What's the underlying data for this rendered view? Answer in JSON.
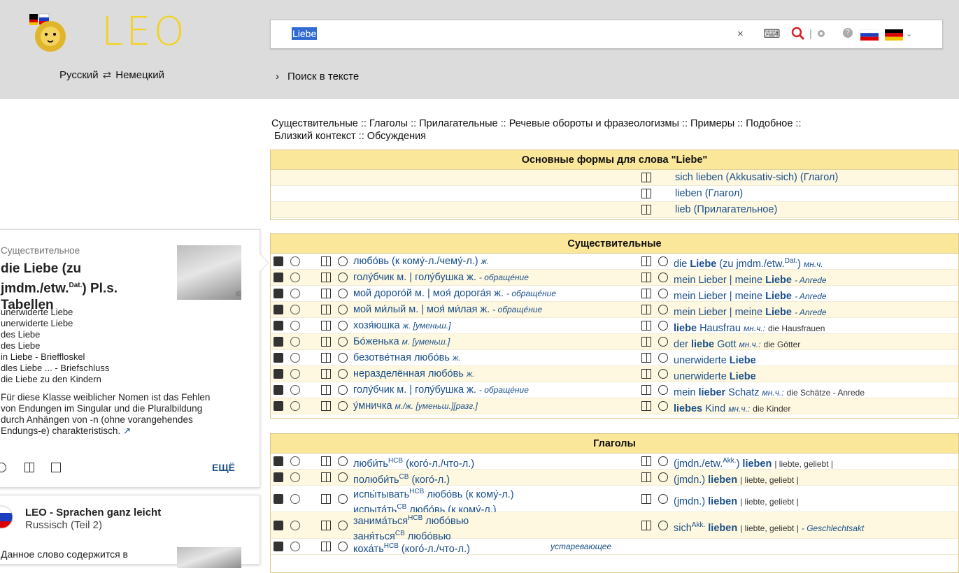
{
  "header": {
    "logo_text": "LEO",
    "lang_from": "Русский",
    "lang_swap": "⇄",
    "lang_to": "Немецкий",
    "fulltext_link": "Поиск в тексте"
  },
  "search": {
    "value": "Liebe",
    "clear": "×",
    "keyboard": "⌨",
    "search_icon": "magnifier-icon",
    "settings_icon": "gear-icon",
    "help": "?"
  },
  "nav": {
    "line1": "Существительные :: Глаголы :: Прилагательные :: Речевые обороты и фразеологизмы :: Примеры :: Подобное ::",
    "line2": "Близкий контекст :: Обсуждения"
  },
  "baseforms": {
    "title": "Основные формы для слова \"Liebe\"",
    "rows": [
      "sich lieben (Akkusativ-sich) (Глагол)",
      "lieben (Глагол)",
      "lieb (Прилагательное)"
    ]
  },
  "nouns": {
    "title": "Существительные",
    "rows": [
      {
        "l": "любо́вь (к кому́-л./чему́-л.)",
        "lt": "ж.",
        "r1": "die ",
        "rb": "Liebe",
        "r2": " (zu jmdm./etw.",
        "rsup": "Dat.",
        "r3": ")",
        "rt": "мн.ч.",
        "rg": ""
      },
      {
        "l": "голу́бчик м. | голу́бушка ж.",
        "lt": "- обраще́ние",
        "r1": "mein Lieber | meine ",
        "rb": "Liebe",
        "r2": "",
        "rsup": "",
        "r3": "",
        "rt": "- Anrede",
        "rg": ""
      },
      {
        "l": "мой дорого́й м. | моя́ дорога́я ж.",
        "lt": "- обраще́ние",
        "r1": "mein Lieber | meine ",
        "rb": "Liebe",
        "r2": "",
        "rsup": "",
        "r3": "",
        "rt": "- Anrede",
        "rg": ""
      },
      {
        "l": "мой ми́лый м. | моя́ ми́лая ж.",
        "lt": "- обраще́ние",
        "r1": "mein Lieber | meine ",
        "rb": "Liebe",
        "r2": "",
        "rsup": "",
        "r3": "",
        "rt": "- Anrede",
        "rg": ""
      },
      {
        "l": "хозя́юшка",
        "lt": "ж. [уменьш.]",
        "r1": "",
        "rb": "liebe",
        "r2": " Hausfrau",
        "rsup": "",
        "r3": "",
        "rt": "мн.ч.:",
        "rg": "die Hausfrauen"
      },
      {
        "l": "Бо́женька",
        "lt": "м. [уменьш.]",
        "r1": "der ",
        "rb": "liebe",
        "r2": " Gott",
        "rsup": "",
        "r3": "",
        "rt": "мн.ч.:",
        "rg": "die Götter"
      },
      {
        "l": "безотве́тная любо́вь",
        "lt": "ж.",
        "r1": "unerwiderte ",
        "rb": "Liebe",
        "r2": "",
        "rsup": "",
        "r3": "",
        "rt": "",
        "rg": ""
      },
      {
        "l": "неразделённая любо́вь",
        "lt": "ж.",
        "r1": "unerwiderte ",
        "rb": "Liebe",
        "r2": "",
        "rsup": "",
        "r3": "",
        "rt": "",
        "rg": ""
      },
      {
        "l": "голу́бчик м. | голу́бушка ж.",
        "lt": "- обраще́ние",
        "r1": "mein ",
        "rb": "lieber",
        "r2": " Schatz",
        "rsup": "",
        "r3": "",
        "rt": "мн.ч.:",
        "rg": "die Schätze  - Anrede"
      },
      {
        "l": "у́мничка",
        "lt": "м./ж. [уменьш.][разг.]",
        "r1": "",
        "rb": "liebes",
        "r2": " Kind",
        "rsup": "",
        "r3": "",
        "rt": "мн.ч.:",
        "rg": "die Kinder"
      }
    ]
  },
  "verbs": {
    "title": "Глаголы",
    "rows": [
      {
        "l": "люби́ть",
        "lsup": "НСВ",
        "l2": " (кого́-л./что-л.)",
        "l3": "",
        "l3sup": "",
        "l4": "",
        "r1": "(jmdn./etw.",
        "rsup": "Akk.",
        "r2": ") ",
        "rb": "lieben",
        "rg": "| liebte, geliebt |",
        "rt": ""
      },
      {
        "l": "полюби́ть",
        "lsup": "СВ",
        "l2": " (кого́-л.)",
        "l3": "",
        "l3sup": "",
        "l4": "",
        "r1": "(jmdn.) ",
        "rsup": "",
        "r2": "",
        "rb": "lieben",
        "rg": "| liebte, geliebt |",
        "rt": ""
      },
      {
        "l": "испы́тывать",
        "lsup": "НСВ",
        "l2": " любо́вь (к кому́-л.)",
        "l3": "испыта́ть",
        "l3sup": "СВ",
        "l4": " любо́вь (к кому́-л.)",
        "r1": "(jmdn.) ",
        "rsup": "",
        "r2": "",
        "rb": "lieben",
        "rg": "| liebte, geliebt |",
        "rt": ""
      },
      {
        "l": "занима́ться",
        "lsup": "НСВ",
        "l2": " любо́вью",
        "l3": "заня́ться",
        "l3sup": "СВ",
        "l4": " любо́вью",
        "r1": "sich",
        "rsup": "Akk.",
        "r2": " ",
        "rb": "lieben",
        "rg": "| liebte, geliebt |",
        "rt": "- Geschlechtsakt"
      },
      {
        "l": "коха́ть",
        "lsup": "НСВ",
        "l2": " (кого́-л./что-л.)",
        "l3": "",
        "l3sup": "",
        "l4": "",
        "r1": "",
        "rsup": "",
        "r2": "",
        "rb": "",
        "rg": "",
        "rt": "устаревающее"
      }
    ]
  },
  "card1": {
    "category": "Существительное",
    "title_a": "die Liebe (zu",
    "title_b": "jmdm./etw.",
    "title_sup": "Dat.",
    "title_c": ") Pl.s.",
    "title_d": "Tabellen",
    "lines": [
      "unerwiderte Liebe",
      "unerwiderte Liebe",
      "des Liebe",
      "des Liebe",
      "in Liebe  - Brieffloskel",
      "dles Liebe ...  - Briefschluss",
      "die Liebe zu den Kindern"
    ],
    "note_1": "Für diese Klasse weiblicher Nomen ist das Fehlen",
    "note_2": "von Endungen im Singular und die Pluralbildung",
    "note_3": "durch Anhängen von -n (ohne vorangehendes",
    "note_4": "Endungs-e) charakteristisch.",
    "more": "ЕЩЁ",
    "copyright": "©"
  },
  "card2": {
    "title": "LEO - Sprachen ganz leicht",
    "subtitle": "Russisch (Teil 2)",
    "text": "Данное слово содержится в"
  },
  "colors": {
    "header_bg": "#dcdcdc",
    "table_header": "#fbe79a",
    "row_alt": "#fef8e0",
    "link": "#1a4f8a",
    "logo": "#f2d31f"
  }
}
